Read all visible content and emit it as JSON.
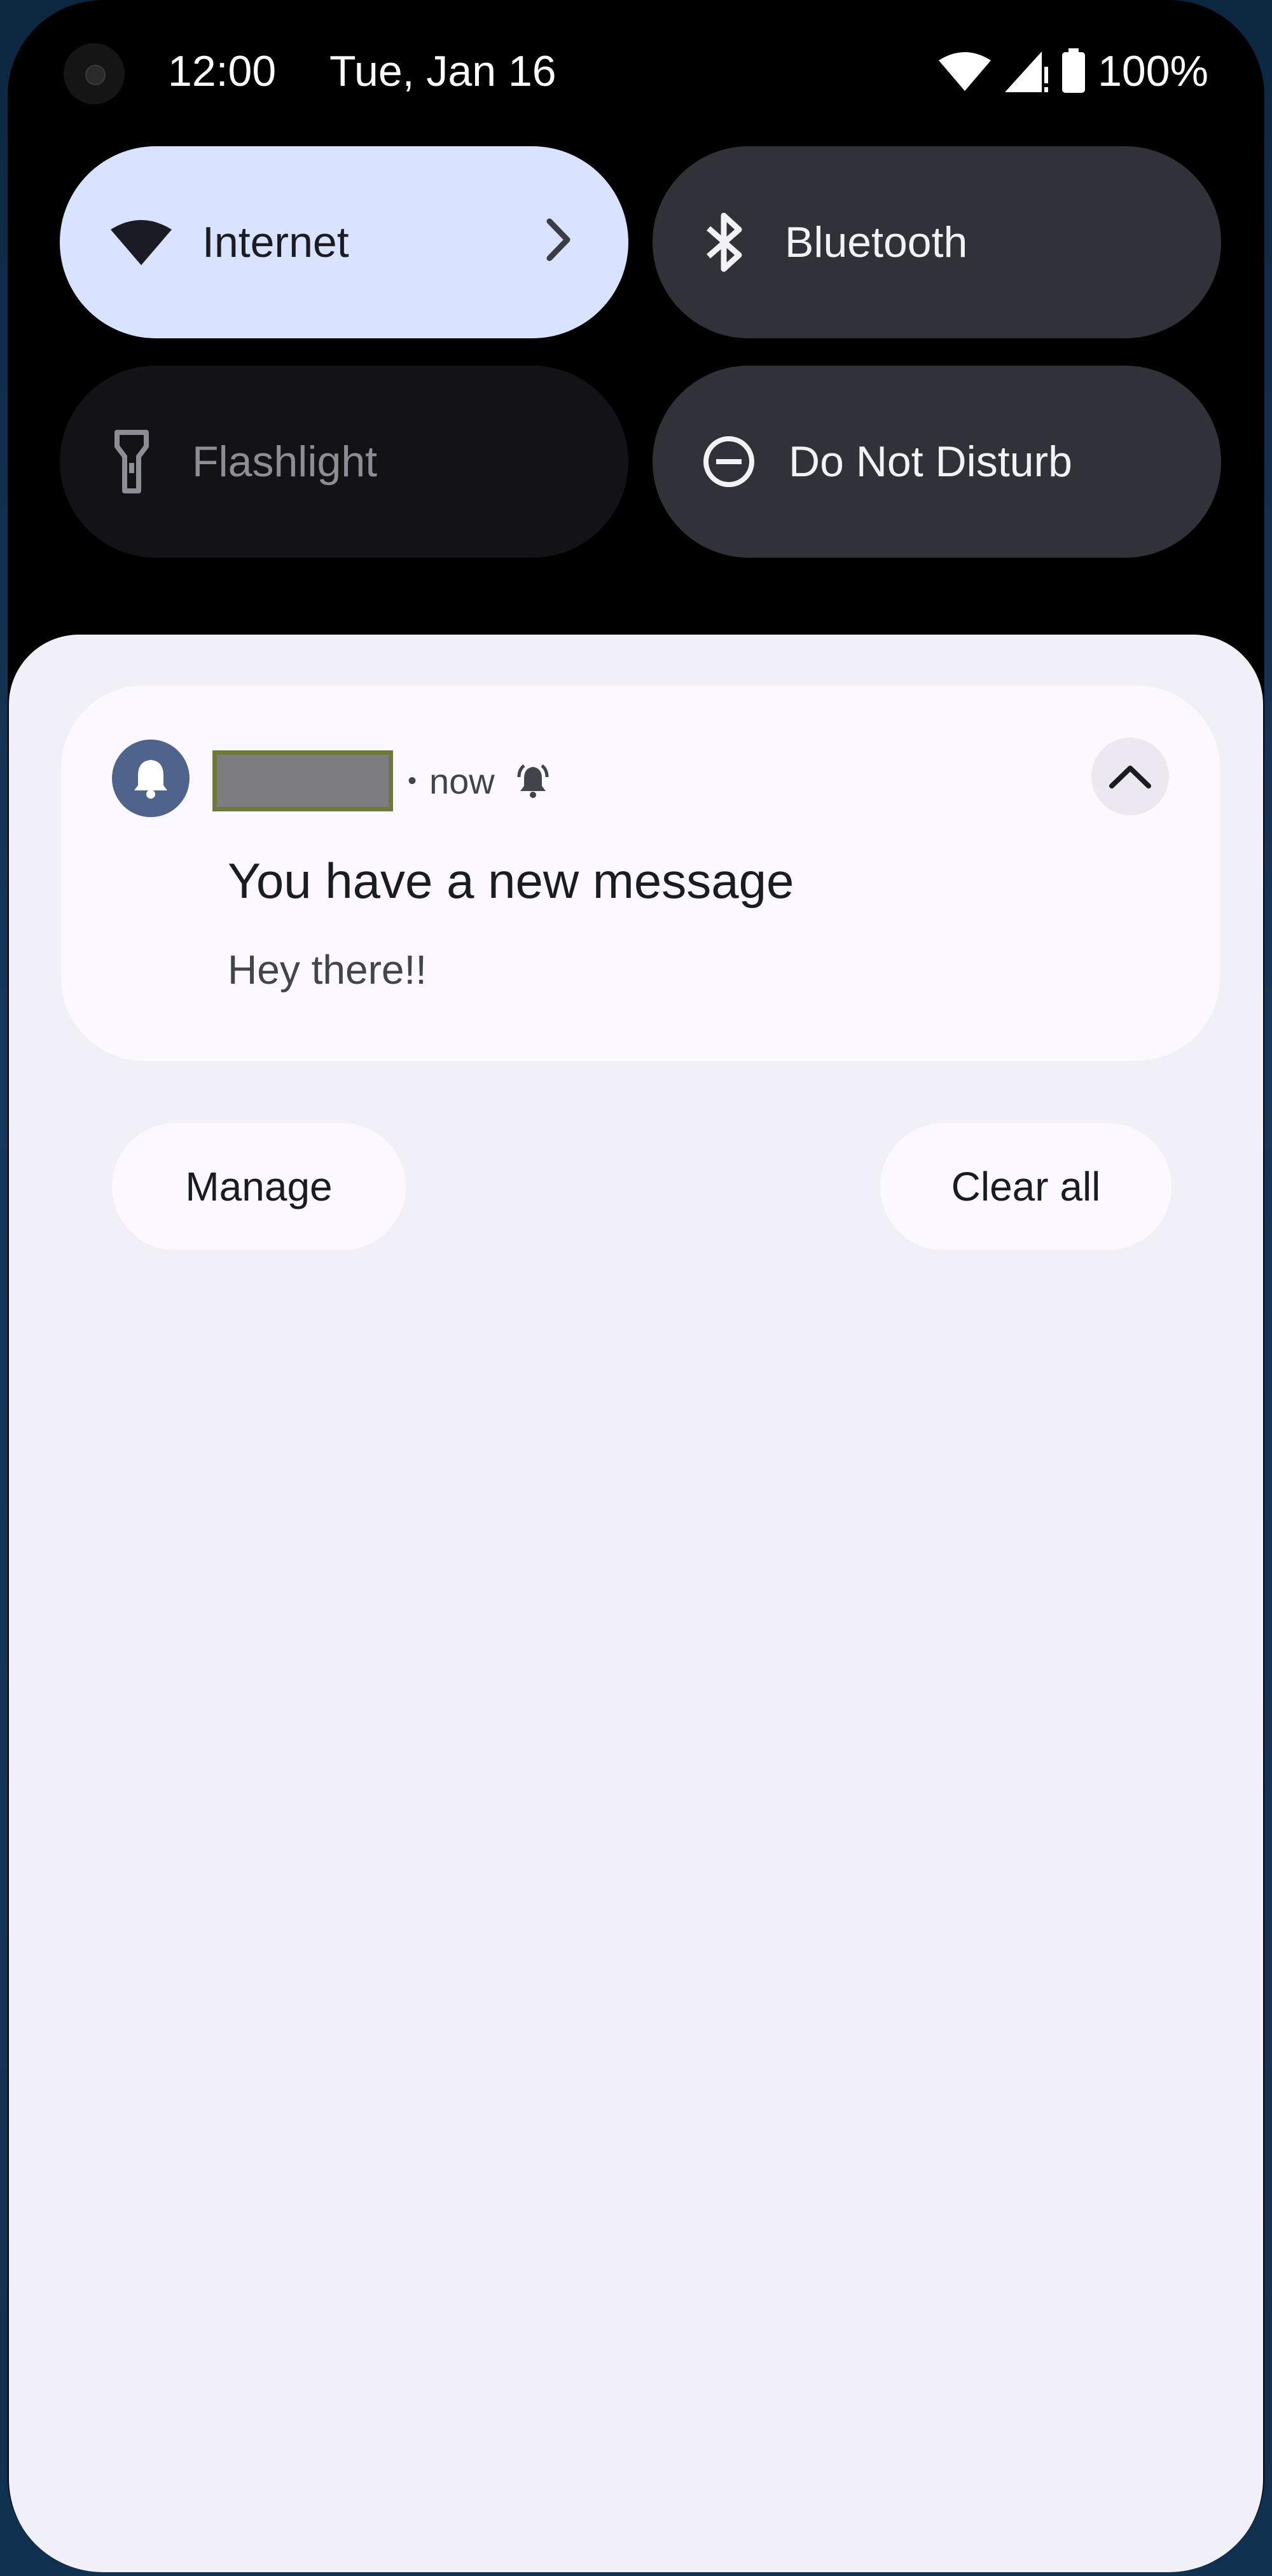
{
  "status_bar": {
    "time": "12:00",
    "date": "Tue, Jan 16",
    "battery_percent": "100%",
    "icons": [
      "camera-icon",
      "wifi-icon",
      "signal-icon",
      "battery-icon"
    ]
  },
  "quick_settings": {
    "tiles": [
      {
        "label": "Internet",
        "icon": "wifi-icon",
        "state": "active",
        "has_chevron": true
      },
      {
        "label": "Bluetooth",
        "icon": "bluetooth-icon",
        "state": "on"
      },
      {
        "label": "Flashlight",
        "icon": "flashlight-icon",
        "state": "off"
      },
      {
        "label": "Do Not Disturb",
        "icon": "do-not-disturb-icon",
        "state": "on"
      }
    ]
  },
  "notification": {
    "app_icon": "bell-icon",
    "timestamp": "now",
    "separator": "•",
    "alert_icon": "alerting-bell-icon",
    "title": "You have a new message",
    "body": "Hey there!!"
  },
  "actions": {
    "manage": "Manage",
    "clear_all": "Clear all"
  },
  "colors": {
    "active_tile": "#d9e2fe",
    "inactive_tile": "#31313a",
    "off_tile": "#131317",
    "panel": "#f1f0f9",
    "card": "#fbf8ff",
    "app_icon_bg": "#4f648c"
  }
}
